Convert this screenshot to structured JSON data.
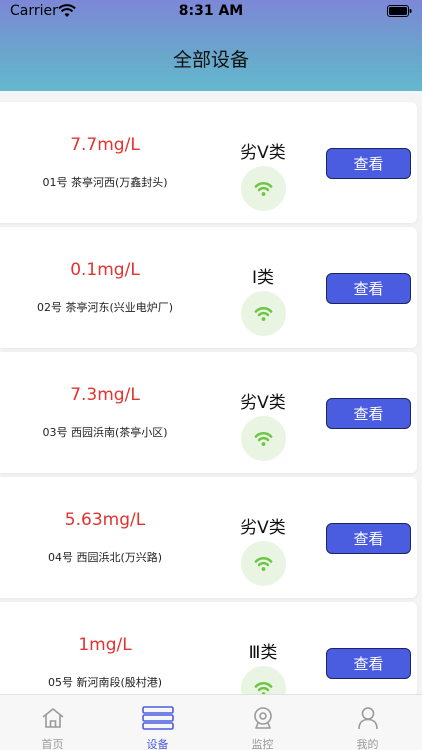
{
  "status_bar": {
    "carrier": "Carrier",
    "time": "8:31 AM",
    "icons": [
      "wifi-icon",
      "battery-icon"
    ]
  },
  "header": {
    "title": "全部设备"
  },
  "devices": [
    {
      "value": "7.7mg/L",
      "station": "01号 茶亭河西(万鑫封头)",
      "grade": "劣Ⅴ类",
      "action": "查看"
    },
    {
      "value": "0.1mg/L",
      "station": "02号 茶亭河东(兴业电炉厂)",
      "grade": "Ⅰ类",
      "action": "查看"
    },
    {
      "value": "7.3mg/L",
      "station": "03号 西园浜南(茶亭小区)",
      "grade": "劣Ⅴ类",
      "action": "查看"
    },
    {
      "value": "5.63mg/L",
      "station": "04号 西园浜北(万兴路)",
      "grade": "劣Ⅴ类",
      "action": "查看"
    },
    {
      "value": "1mg/L",
      "station": "05号 新河南段(殷村港)",
      "grade": "Ⅲ类",
      "action": "查看"
    }
  ],
  "tabbar": {
    "items": [
      {
        "label": "首页",
        "icon": "home-icon"
      },
      {
        "label": "设备",
        "icon": "device-list-icon",
        "active": true
      },
      {
        "label": "监控",
        "icon": "camera-icon"
      },
      {
        "label": "我的",
        "icon": "user-icon"
      }
    ]
  },
  "colors": {
    "value_red": "#e2332e",
    "accent": "#4a5ce0",
    "signal_green": "#6cc644",
    "header_gradient_top": "#7c87d7",
    "header_gradient_bottom": "#64b8cf"
  }
}
